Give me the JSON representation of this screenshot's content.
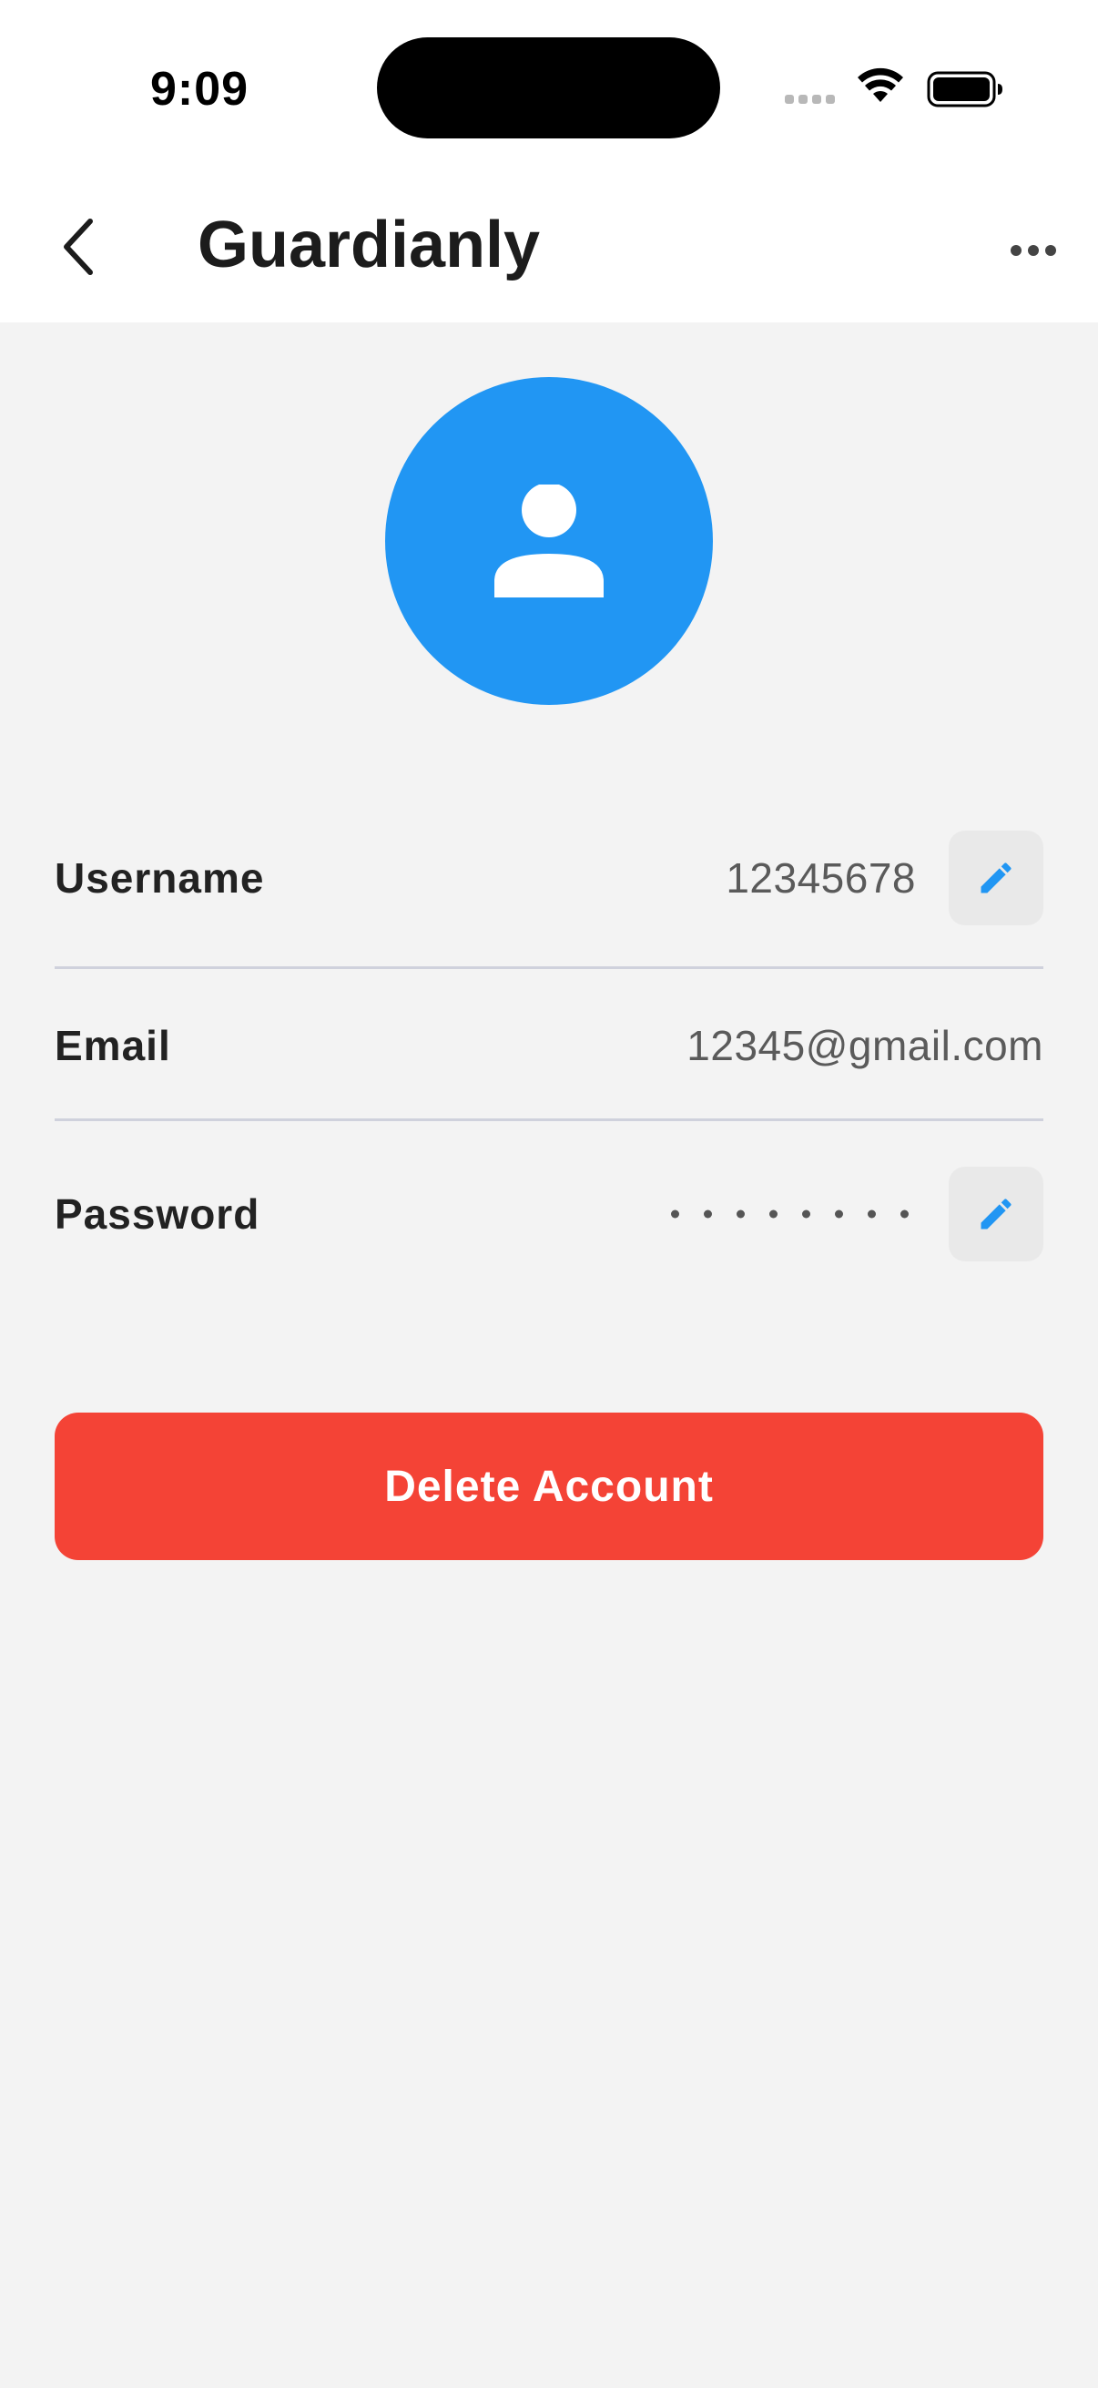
{
  "status_bar": {
    "time": "9:09"
  },
  "nav": {
    "title": "Guardianly",
    "back_icon": "chevron-left-icon",
    "more_icon": "ellipsis-icon"
  },
  "avatar": {
    "icon": "person-icon",
    "color": "#2196f3"
  },
  "profile": {
    "username": {
      "label": "Username",
      "value": "12345678",
      "edit_icon": "pencil-icon"
    },
    "email": {
      "label": "Email",
      "value": "12345@gmail.com"
    },
    "password": {
      "label": "Password",
      "masked_length": 8,
      "edit_icon": "pencil-icon"
    }
  },
  "actions": {
    "delete_label": "Delete Account",
    "delete_color": "#f44336"
  },
  "colors": {
    "accent": "#2196f3",
    "background": "#f3f3f3",
    "danger": "#f44336"
  }
}
